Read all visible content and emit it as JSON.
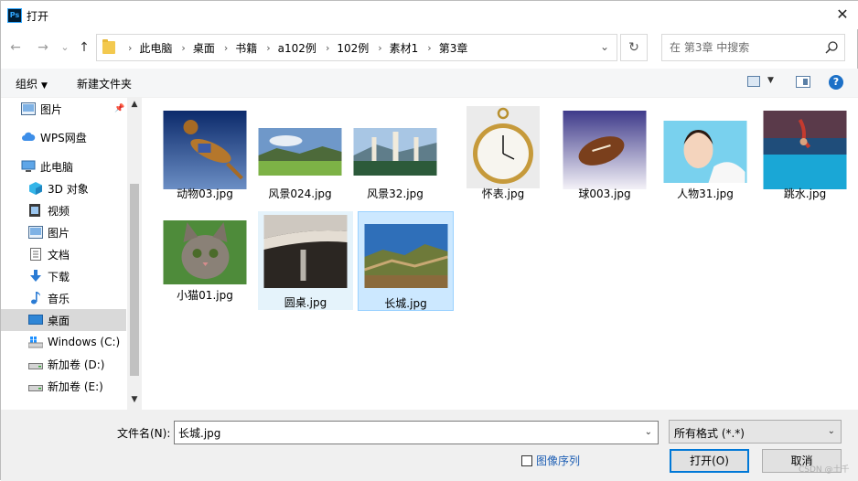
{
  "window": {
    "title": "打开",
    "app_icon": "Ps",
    "close": "✕"
  },
  "nav": {
    "back": "←",
    "forward": "→",
    "recent": "⌄",
    "up": "↑"
  },
  "address": {
    "crumbs": [
      "此电脑",
      "桌面",
      "书籍",
      "a102例",
      "102例",
      "素材1",
      "第3章"
    ],
    "separator": "›",
    "refresh": "↻"
  },
  "search": {
    "placeholder": "在 第3章 中搜索"
  },
  "toolbar": {
    "organize": "组织",
    "organize_caret": "▼",
    "new_folder": "新建文件夹",
    "view_caret": "▼",
    "help": "?"
  },
  "sidebar": {
    "items": [
      {
        "label": "图片",
        "icon": "pictures-icon",
        "pinned": true
      },
      {
        "label": "WPS网盘",
        "icon": "cloud-icon"
      },
      {
        "label": "此电脑",
        "icon": "computer-icon"
      },
      {
        "label": "3D 对象",
        "icon": "3d-objects-icon"
      },
      {
        "label": "视频",
        "icon": "video-icon"
      },
      {
        "label": "图片",
        "icon": "pictures-icon"
      },
      {
        "label": "文档",
        "icon": "documents-icon"
      },
      {
        "label": "下载",
        "icon": "download-icon"
      },
      {
        "label": "音乐",
        "icon": "music-icon"
      },
      {
        "label": "桌面",
        "icon": "desktop-icon",
        "selected": true
      },
      {
        "label": "Windows (C:)",
        "icon": "windows-drive-icon"
      },
      {
        "label": "新加卷 (D:)",
        "icon": "drive-icon"
      },
      {
        "label": "新加卷 (E:)",
        "icon": "drive-icon"
      }
    ],
    "scroll_up": "▲",
    "scroll_down": "▼"
  },
  "files": [
    {
      "name": "动物03.jpg",
      "thumb": "dog-jumping"
    },
    {
      "name": "风景024.jpg",
      "thumb": "meadow-landscape"
    },
    {
      "name": "风景32.jpg",
      "thumb": "pagodas-landscape"
    },
    {
      "name": "怀表.jpg",
      "thumb": "pocket-watch"
    },
    {
      "name": "球003.jpg",
      "thumb": "football"
    },
    {
      "name": "人物31.jpg",
      "thumb": "portrait-girl"
    },
    {
      "name": "跳水.jpg",
      "thumb": "diver"
    },
    {
      "name": "小猫01.jpg",
      "thumb": "kitten"
    },
    {
      "name": "圆桌.jpg",
      "thumb": "round-table",
      "state": "hover"
    },
    {
      "name": "长城.jpg",
      "thumb": "great-wall",
      "state": "selected"
    }
  ],
  "bottom": {
    "filename_label": "文件名(N):",
    "filename_value": "长城.jpg",
    "format_value": "所有格式 (*.*)",
    "dropdown_caret": "⌄",
    "image_sequence_label": "图像序列",
    "open_label": "打开(O)",
    "cancel_label": "取消",
    "watermark": "CSDN @土千"
  },
  "colors": {
    "accent": "#0078d7",
    "selection": "#cce8ff",
    "hover": "#e5f3fb",
    "link": "#1e5fb4"
  }
}
